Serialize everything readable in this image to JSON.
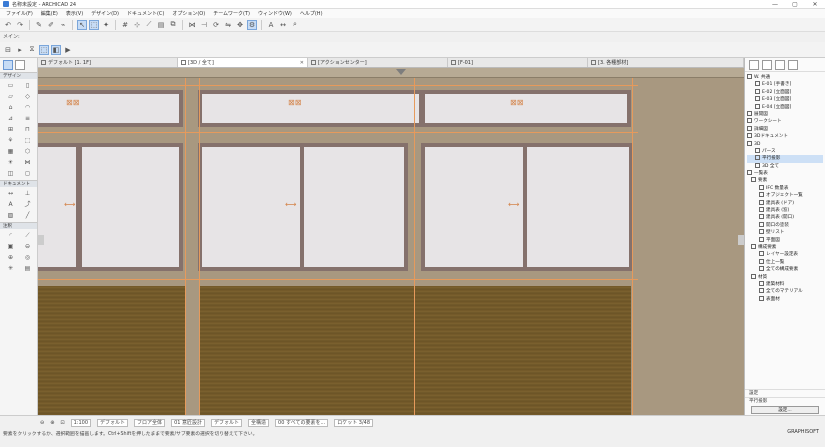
{
  "window": {
    "title": "名称未設定 - ARCHICAD 24",
    "controls": [
      "—",
      "▢",
      "✕"
    ]
  },
  "menu": [
    "ファイル(F)",
    "編集(E)",
    "表示(V)",
    "デザイン(D)",
    "ドキュメント(C)",
    "オプション(O)",
    "チームワーク(T)",
    "ウィンドウ(W)",
    "ヘルプ(H)"
  ],
  "infobar": {
    "text": "メイン:"
  },
  "tabs": [
    {
      "label": "デフォルト [1. 1F]",
      "active": false
    },
    {
      "label": "[3D / 全て]",
      "active": true
    },
    {
      "label": "[アクションセンター]",
      "active": false
    },
    {
      "label": "[F-01]",
      "active": false
    },
    {
      "label": "[3. 各種部材]",
      "active": false
    }
  ],
  "left_panel": {
    "sections": [
      "デザイン",
      "ドキュメント",
      "注釈"
    ]
  },
  "canvas": {
    "background": "#a89880",
    "window_glass": "#e7e4e6",
    "frame_color": "#85716c",
    "guide_color": "#e69a5c"
  },
  "navigator": {
    "items": [
      {
        "label": "W. 共通",
        "sel": false
      },
      {
        "label": "E-01 [手書き]",
        "sel": false
      },
      {
        "label": "E-02 [立面図]",
        "sel": false
      },
      {
        "label": "E-03 [立面図]",
        "sel": false
      },
      {
        "label": "E-04 [立面図]",
        "sel": false
      },
      {
        "label": "展開図",
        "sel": false
      },
      {
        "label": "ワークシート",
        "sel": false
      },
      {
        "label": "詳細図",
        "sel": false
      },
      {
        "label": "3Dドキュメント",
        "sel": false
      },
      {
        "label": "3D",
        "sel": false
      },
      {
        "label": "パース",
        "sel": false
      },
      {
        "label": "平行投影",
        "sel": true
      },
      {
        "label": "3D 全て",
        "sel": false
      },
      {
        "label": "一覧表",
        "sel": false
      },
      {
        "label": "要素",
        "sel": false
      },
      {
        "label": "IFC 数量表",
        "sel": false
      },
      {
        "label": "オブジェクト一覧",
        "sel": false
      },
      {
        "label": "建具表 (ドア)",
        "sel": false
      },
      {
        "label": "建具表 (窓)",
        "sel": false
      },
      {
        "label": "建具表 (開口)",
        "sel": false
      },
      {
        "label": "開口の塗装",
        "sel": false
      },
      {
        "label": "壁リスト",
        "sel": false
      },
      {
        "label": "平面図",
        "sel": false
      },
      {
        "label": "構成要素",
        "sel": false
      },
      {
        "label": "レイヤー設定表",
        "sel": false
      },
      {
        "label": "仕上一覧",
        "sel": false
      },
      {
        "label": "全ての構成要素",
        "sel": false
      },
      {
        "label": "材質",
        "sel": false
      },
      {
        "label": "建築材料",
        "sel": false
      },
      {
        "label": "全てのマテリアル",
        "sel": false
      },
      {
        "label": "表面材",
        "sel": false
      }
    ],
    "bottom_label": "設定",
    "bottom_row": "平行投影",
    "bottom_button": "設定..."
  },
  "status": {
    "zoom": "1:100",
    "model_view": "デフォルト",
    "layer": "フロア全体",
    "story": "01 意匠設計",
    "renovation": "デフォルト",
    "structure": "全構造",
    "message_right": "00 すべての要素を...",
    "units": "ロケット 3/48",
    "hint": "要素をクリックするか、選択範囲を描画します。Ctrl+Shiftを押したままで要素/サブ要素の選択を切り替えて下さい。",
    "brand": "GRAPHISOFT"
  }
}
